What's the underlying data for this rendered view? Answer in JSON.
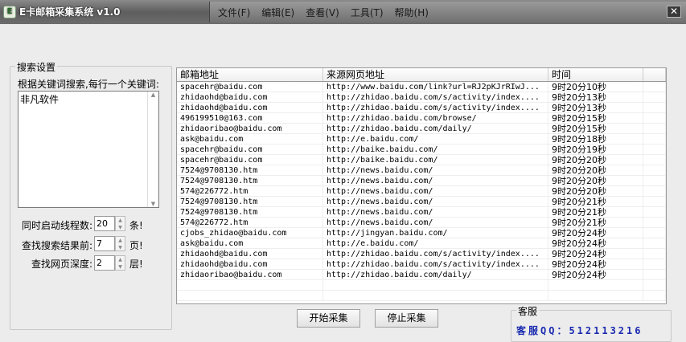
{
  "window": {
    "title": "E卡邮箱采集系统 v1.0",
    "logo": "E",
    "close": "✕"
  },
  "menu": [
    "文件(F)",
    "编辑(E)",
    "查看(V)",
    "工具(T)",
    "帮助(H)"
  ],
  "search": {
    "group_title": "搜索设置",
    "instruction": "根据关键词搜索,每行一个关键词:",
    "keywords": "非凡软件",
    "threads_label": "同时启动线程数:",
    "threads_value": "20",
    "threads_unit": "条!",
    "pages_label": "查找搜索结果前:",
    "pages_value": "7",
    "pages_unit": "页!",
    "depth_label": "查找网页深度:",
    "depth_value": "2",
    "depth_unit": "层!"
  },
  "table": {
    "headers": [
      "邮箱地址",
      "来源网页地址",
      "时间"
    ],
    "rows": [
      [
        "spacehr@baidu.com",
        "http://www.baidu.com/link?url=RJ2pKJrRIwJ...",
        "9时20分10秒"
      ],
      [
        "zhidaohd@baidu.com",
        "http://zhidao.baidu.com/s/activity/index....",
        "9时20分13秒"
      ],
      [
        "zhidaohd@baidu.com",
        "http://zhidao.baidu.com/s/activity/index....",
        "9时20分13秒"
      ],
      [
        "496199510@163.com",
        "http://zhidao.baidu.com/browse/",
        "9时20分15秒"
      ],
      [
        "zhidaoribao@baidu.com",
        "http://zhidao.baidu.com/daily/",
        "9时20分15秒"
      ],
      [
        "ask@baidu.com",
        "http://e.baidu.com/",
        "9时20分18秒"
      ],
      [
        "spacehr@baidu.com",
        "http://baike.baidu.com/",
        "9时20分19秒"
      ],
      [
        "spacehr@baidu.com",
        "http://baike.baidu.com/",
        "9时20分20秒"
      ],
      [
        "7524@9708130.htm",
        "http://news.baidu.com/",
        "9时20分20秒"
      ],
      [
        "7524@9708130.htm",
        "http://news.baidu.com/",
        "9时20分20秒"
      ],
      [
        "574@226772.htm",
        "http://news.baidu.com/",
        "9时20分20秒"
      ],
      [
        "7524@9708130.htm",
        "http://news.baidu.com/",
        "9时20分21秒"
      ],
      [
        "7524@9708130.htm",
        "http://news.baidu.com/",
        "9时20分21秒"
      ],
      [
        "574@226772.htm",
        "http://news.baidu.com/",
        "9时20分21秒"
      ],
      [
        "cjobs_zhidao@baidu.com",
        "http://jingyan.baidu.com/",
        "9时20分24秒"
      ],
      [
        "ask@baidu.com",
        "http://e.baidu.com/",
        "9时20分24秒"
      ],
      [
        "zhidaohd@baidu.com",
        "http://zhidao.baidu.com/s/activity/index....",
        "9时20分24秒"
      ],
      [
        "zhidaohd@baidu.com",
        "http://zhidao.baidu.com/s/activity/index....",
        "9时20分24秒"
      ],
      [
        "zhidaoribao@baidu.com",
        "http://zhidao.baidu.com/daily/",
        "9时20分24秒"
      ]
    ]
  },
  "buttons": {
    "start": "开始采集",
    "stop": "停止采集"
  },
  "support": {
    "group_title": "客服",
    "qq": "客服QQ：512113216"
  }
}
